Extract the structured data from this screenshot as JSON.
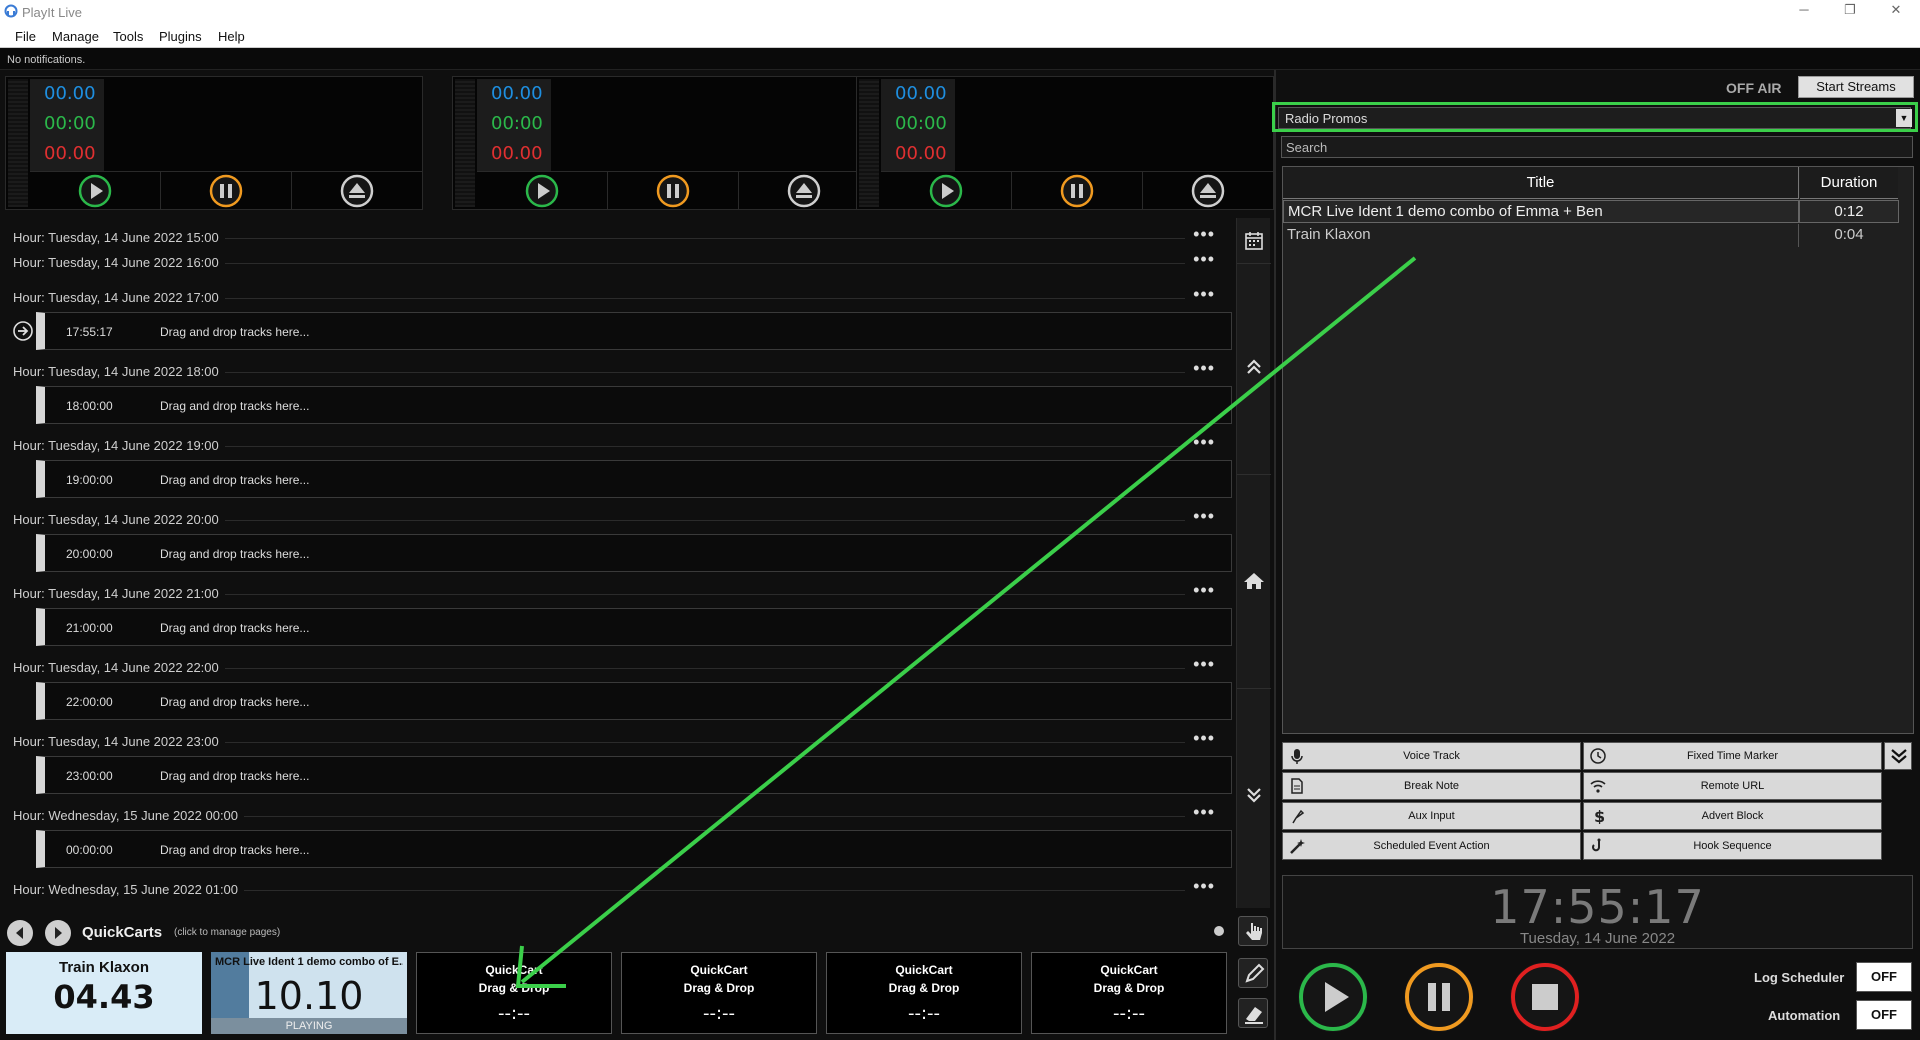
{
  "window": {
    "title": "PlayIt Live",
    "minimize": "─",
    "restore": "❐",
    "close": "✕"
  },
  "menu": [
    "File",
    "Manage",
    "Tools",
    "Plugins",
    "Help"
  ],
  "notification": "No notifications.",
  "players": [
    {
      "remaining": "00.00",
      "elapsed": "00:00",
      "intro": "00.00"
    },
    {
      "remaining": "00.00",
      "elapsed": "00:00",
      "intro": "00.00"
    },
    {
      "remaining": "00.00",
      "elapsed": "00:00",
      "intro": "00.00"
    }
  ],
  "log": {
    "hours": [
      {
        "label": "Hour: Tuesday, 14 June 2022 15:00",
        "slot": null
      },
      {
        "label": "Hour: Tuesday, 14 June 2022 16:00",
        "slot": null
      },
      {
        "label": "Hour: Tuesday, 14 June 2022 17:00",
        "slot": {
          "time": "17:55:17",
          "text": "Drag and drop tracks here..."
        }
      },
      {
        "label": "Hour: Tuesday, 14 June 2022 18:00",
        "slot": {
          "time": "18:00:00",
          "text": "Drag and drop tracks here..."
        }
      },
      {
        "label": "Hour: Tuesday, 14 June 2022 19:00",
        "slot": {
          "time": "19:00:00",
          "text": "Drag and drop tracks here..."
        }
      },
      {
        "label": "Hour: Tuesday, 14 June 2022 20:00",
        "slot": {
          "time": "20:00:00",
          "text": "Drag and drop tracks here..."
        }
      },
      {
        "label": "Hour: Tuesday, 14 June 2022 21:00",
        "slot": {
          "time": "21:00:00",
          "text": "Drag and drop tracks here..."
        }
      },
      {
        "label": "Hour: Tuesday, 14 June 2022 22:00",
        "slot": {
          "time": "22:00:00",
          "text": "Drag and drop tracks here..."
        }
      },
      {
        "label": "Hour: Tuesday, 14 June 2022 23:00",
        "slot": {
          "time": "23:00:00",
          "text": "Drag and drop tracks here..."
        }
      },
      {
        "label": "Hour: Wednesday, 15 June 2022 00:00",
        "slot": {
          "time": "00:00:00",
          "text": "Drag and drop tracks here..."
        }
      },
      {
        "label": "Hour: Wednesday, 15 June 2022 01:00",
        "slot": null
      }
    ],
    "more": "•••"
  },
  "quickcarts": {
    "label": "QuickCarts",
    "hint": "(click to manage pages)",
    "carts": [
      {
        "kind": "light",
        "name": "Train Klaxon",
        "time": "04.43"
      },
      {
        "kind": "playing",
        "name": "MCR Live Ident 1 demo combo of E...",
        "time": "10.10",
        "status": "PLAYING"
      },
      {
        "kind": "empty",
        "line1": "QuickCart",
        "line2": "Drag & Drop",
        "time": "--:--"
      },
      {
        "kind": "empty",
        "line1": "QuickCart",
        "line2": "Drag & Drop",
        "time": "--:--"
      },
      {
        "kind": "empty",
        "line1": "QuickCart",
        "line2": "Drag & Drop",
        "time": "--:--"
      },
      {
        "kind": "empty",
        "line1": "QuickCart",
        "line2": "Drag & Drop",
        "time": "--:--"
      }
    ]
  },
  "streams": {
    "status": "OFF AIR",
    "button": "Start Streams"
  },
  "playlist": {
    "selected": "Radio Promos",
    "search_placeholder": "Search",
    "columns": {
      "title": "Title",
      "duration": "Duration"
    },
    "rows": [
      {
        "title": "MCR Live Ident 1 demo combo of Emma + Ben",
        "duration": "0:12"
      },
      {
        "title": "Train Klaxon",
        "duration": "0:04"
      }
    ]
  },
  "actions": [
    {
      "label": "Voice Track",
      "icon": "microphone-icon"
    },
    {
      "label": "Fixed Time Marker",
      "icon": "clock-icon"
    },
    {
      "label": "Break Note",
      "icon": "document-icon"
    },
    {
      "label": "Remote URL",
      "icon": "wifi-icon"
    },
    {
      "label": "Aux Input",
      "icon": "plug-icon"
    },
    {
      "label": "Advert Block",
      "icon": "dollar-icon"
    },
    {
      "label": "Scheduled Event Action",
      "icon": "wand-icon"
    },
    {
      "label": "Hook Sequence",
      "icon": "hook-icon"
    }
  ],
  "clock": {
    "time": "17:55:17",
    "date": "Tuesday, 14 June 2022"
  },
  "toggles": [
    {
      "label": "Log Scheduler",
      "value": "OFF"
    },
    {
      "label": "Automation",
      "value": "OFF"
    }
  ],
  "colors": {
    "remaining": "#1e8fe0",
    "elapsed": "#2bb84a",
    "intro": "#e03030",
    "play": "#2bb84a",
    "pause": "#f09a20",
    "stop": "#e02020",
    "highlight": "#3bcf4a"
  }
}
